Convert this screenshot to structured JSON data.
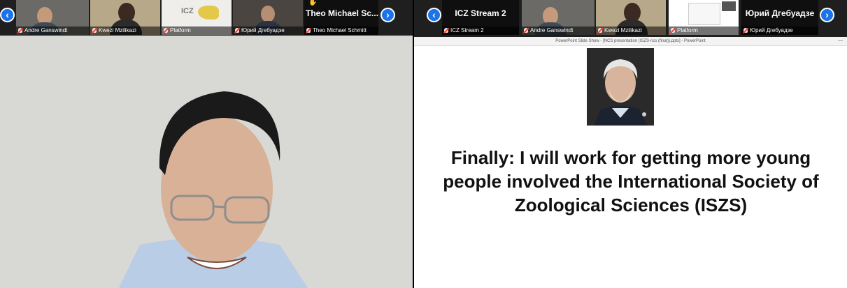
{
  "left_strip": {
    "tiles": [
      {
        "name": "Andre Ganswindt"
      },
      {
        "name": "Kwezi Mzilikazi"
      },
      {
        "name": "Platform",
        "logo_text": "ICZ"
      },
      {
        "name": "Юрий Дгебуадзе"
      },
      {
        "name": "Theo Michael Schmitt",
        "big_name": "Theo Michael Sc..."
      }
    ]
  },
  "right_strip": {
    "tiles": [
      {
        "name": "ICZ Stream 2",
        "big_name": "ICZ Stream 2"
      },
      {
        "name": "Andre Ganswindt"
      },
      {
        "name": "Kwezi Mzilikazi"
      },
      {
        "name": "Platform"
      },
      {
        "name": "Юрий Дгебуадзе",
        "big_name": "Юрий Дгебуадзе"
      }
    ]
  },
  "ppt": {
    "window_title": "PowerPoint Slide Show - [NCS presentation (ISZS-ncs (final)).pptx] - PowerPoint",
    "minimize": "—",
    "slide_text": "Finally: I will work for getting more young people involved the International Society of Zoological Sciences (ISZS)"
  },
  "nav": {
    "prev": "‹",
    "next": "›"
  },
  "colors": {
    "accent": "#1a73e8",
    "muted_mic": "#ff3b30"
  }
}
